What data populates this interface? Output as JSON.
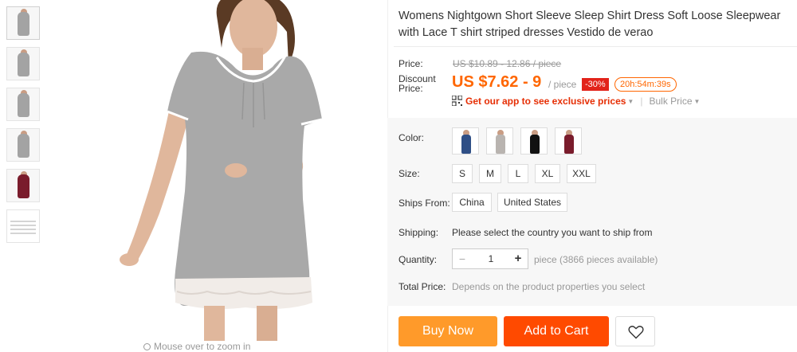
{
  "product": {
    "title": "Womens Nightgown Short Sleeve Sleep Shirt Dress Soft Loose Sleepwear with Lace T shirt striped dresses Vestido de verao"
  },
  "gallery": {
    "zoom_hint": "Mouse over to zoom in",
    "thumb_colors": [
      "#a3a3a3",
      "#a3a3a3",
      "#a3a3a3",
      "#a3a3a3",
      "#7a1c2c"
    ]
  },
  "price": {
    "label": "Price:",
    "original": "US $10.89 - 12.86 / piece",
    "discount_label": "Discount Price:",
    "current": "US $7.62 - 9",
    "unit": "/ piece",
    "discount_badge": "-30%",
    "timer": "20h:54m:39s",
    "app_promo": "Get our app to see exclusive prices",
    "bulk_price": "Bulk Price"
  },
  "color": {
    "label": "Color:",
    "swatches": [
      {
        "name": "blue",
        "hex": "#2f4f86"
      },
      {
        "name": "gray",
        "hex": "#b9b4b0"
      },
      {
        "name": "black",
        "hex": "#111111"
      },
      {
        "name": "wine",
        "hex": "#7a1c2c"
      }
    ]
  },
  "size": {
    "label": "Size:",
    "options": [
      "S",
      "M",
      "L",
      "XL",
      "XXL"
    ]
  },
  "ships_from": {
    "label": "Ships From:",
    "options": [
      "China",
      "United States"
    ]
  },
  "shipping": {
    "label": "Shipping:",
    "text": "Please select the country you want to ship from"
  },
  "quantity": {
    "label": "Quantity:",
    "value": "1",
    "minus": "−",
    "plus": "+",
    "note": "piece (3866 pieces available)"
  },
  "total": {
    "label": "Total Price:",
    "text": "Depends on the product properties you select"
  },
  "actions": {
    "buy_now": "Buy Now",
    "add_to_cart": "Add to Cart"
  },
  "colors": {
    "accent_orange": "#ff6600",
    "buy_now_bg": "#ff9a2a",
    "add_to_cart_bg": "#ff4a00",
    "badge_red": "#e2231a"
  }
}
